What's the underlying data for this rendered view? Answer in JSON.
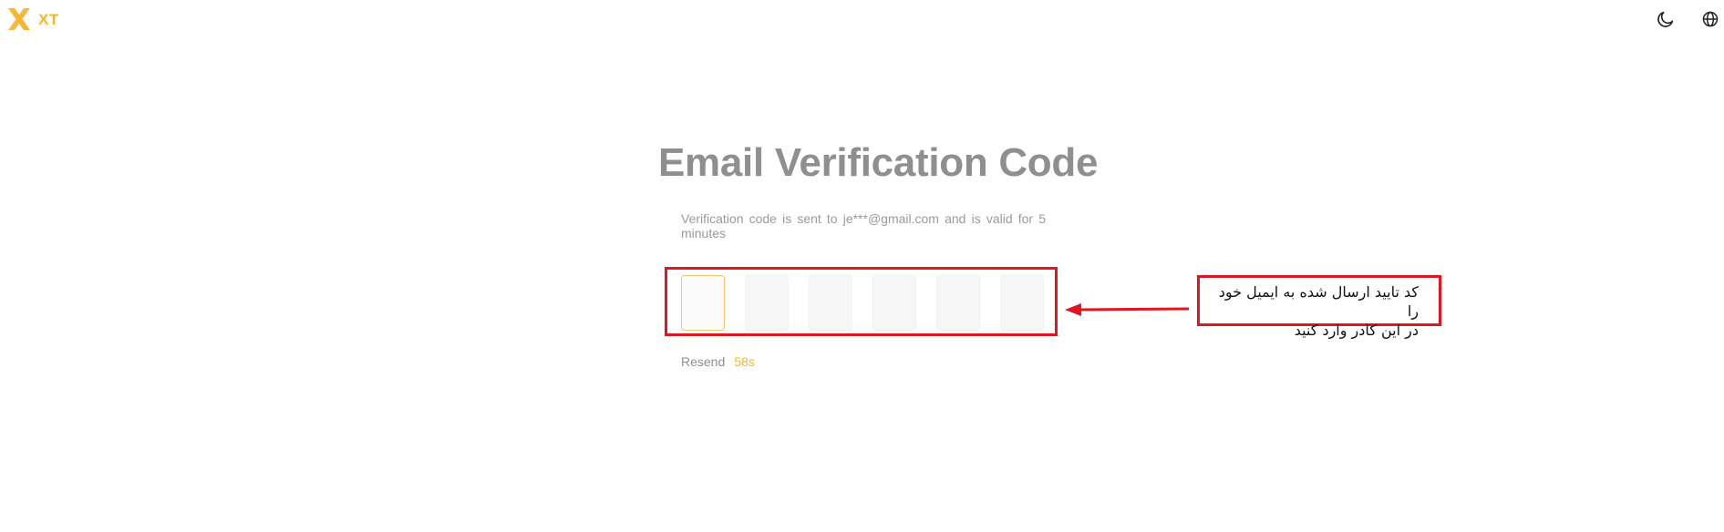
{
  "header": {
    "logo_text": "XT",
    "brand_color": "#f5b52e",
    "icons": [
      "moon-icon",
      "globe-icon"
    ]
  },
  "main": {
    "title": "Email Verification Code",
    "description": "Verification code is sent to je***@gmail.com and is valid for 5 minutes",
    "code_cells": [
      "",
      "",
      "",
      "",
      "",
      ""
    ],
    "resend_label": "Resend",
    "resend_timer": "58s",
    "accent_color": "#f5b52e"
  },
  "annotation": {
    "note_line1": "کد تایید ارسال شده به ایمیل خود را",
    "note_line2": "در این کادر وارد کنید",
    "highlight_color": "#e0161e"
  }
}
